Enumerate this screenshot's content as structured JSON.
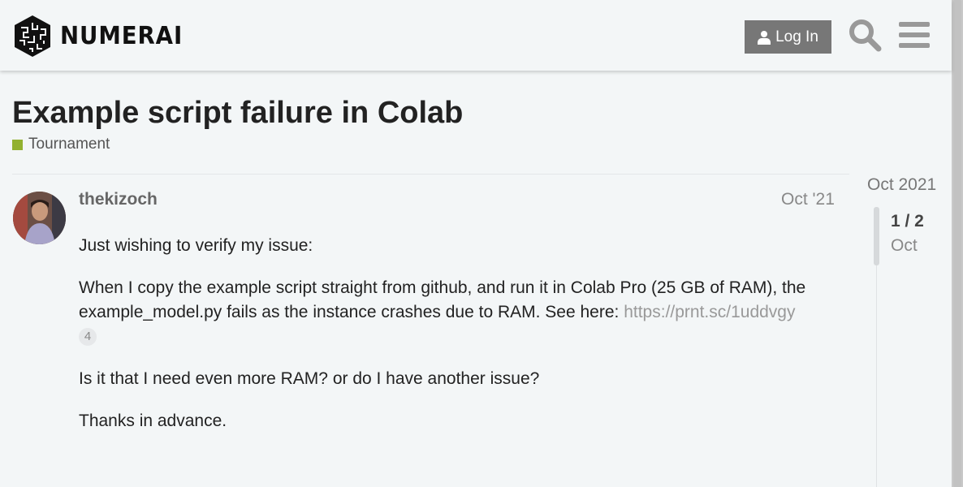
{
  "header": {
    "brand": "NUMERAI",
    "login_label": "Log In",
    "search_icon": "search-icon",
    "menu_icon": "hamburger-menu-icon"
  },
  "topic": {
    "title": "Example script failure in Colab",
    "category": "Tournament",
    "category_color": "#92b130"
  },
  "post": {
    "username": "thekizoch",
    "date": "Oct '21",
    "p1": "Just wishing to verify my issue:",
    "p2": "When I copy the example script straight from github, and run it in Colab Pro (25 GB of RAM), the example_model.py fails as the instance crashes due to RAM. See here: ",
    "link_text": "https://prnt.sc/1uddvgy",
    "link_clicks": "4",
    "p3": "Is it that I need even more RAM? or do I have another issue?",
    "p4": "Thanks in advance."
  },
  "timeline": {
    "top_date": "Oct 2021",
    "position": "1 / 2",
    "month": "Oct"
  }
}
